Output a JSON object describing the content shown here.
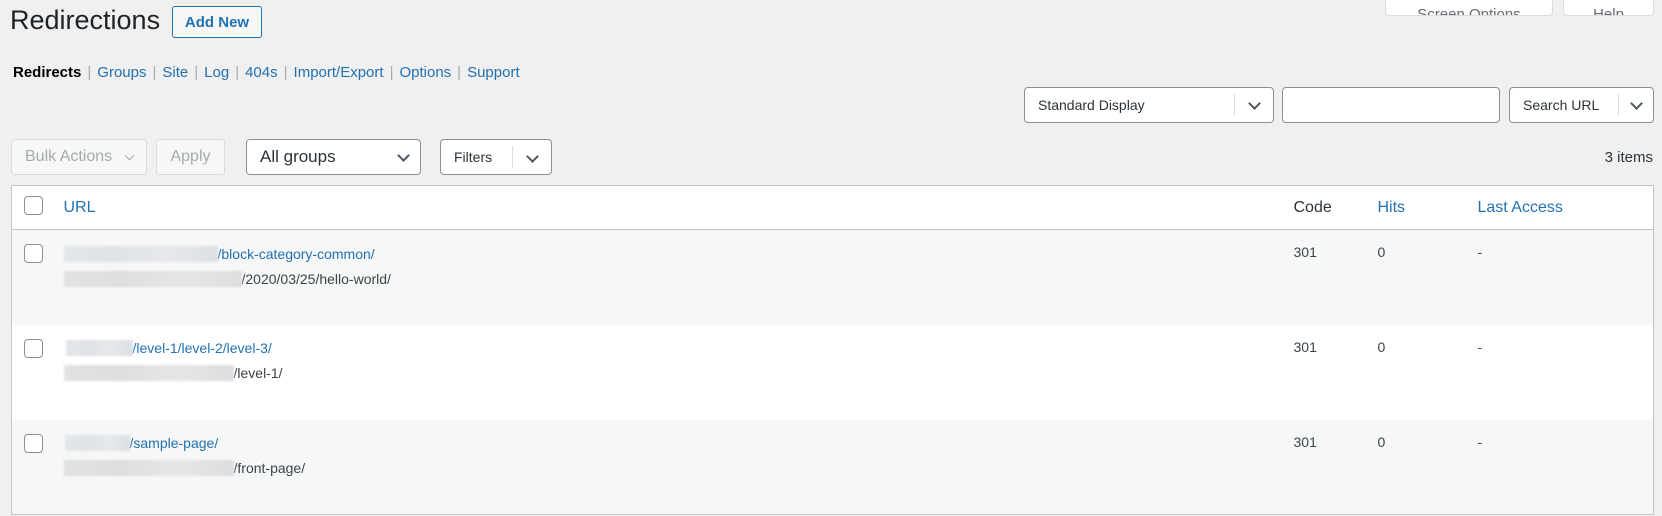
{
  "header": {
    "title": "Redirections",
    "add_new": "Add New",
    "screen_options": "Screen Options",
    "help": "Help"
  },
  "subnav": [
    {
      "label": "Redirects",
      "current": true
    },
    {
      "label": "Groups"
    },
    {
      "label": "Site"
    },
    {
      "label": "Log"
    },
    {
      "label": "404s"
    },
    {
      "label": "Import/Export"
    },
    {
      "label": "Options"
    },
    {
      "label": "Support"
    }
  ],
  "search": {
    "display_select": "Standard Display",
    "input_value": "",
    "input_placeholder": "",
    "search_select": "Search URL"
  },
  "toolbar": {
    "bulk_actions": "Bulk Actions",
    "apply": "Apply",
    "groups_select": "All groups",
    "filters": "Filters",
    "count": "3 items"
  },
  "table": {
    "columns": {
      "url": "URL",
      "code": "Code",
      "hits": "Hits",
      "last_access": "Last Access"
    },
    "rows": [
      {
        "source": "/block-category-common/",
        "target": "/2020/03/25/hello-world/",
        "code": "301",
        "hits": "0",
        "last_access": "-"
      },
      {
        "source": "/level-1/level-2/level-3/",
        "target": "/level-1/",
        "code": "301",
        "hits": "0",
        "last_access": "-"
      },
      {
        "source": "/sample-page/",
        "target": "/front-page/",
        "code": "301",
        "hits": "0",
        "last_access": "-"
      }
    ]
  },
  "colors": {
    "link": "#2271b1",
    "background": "#f0f0f1"
  }
}
